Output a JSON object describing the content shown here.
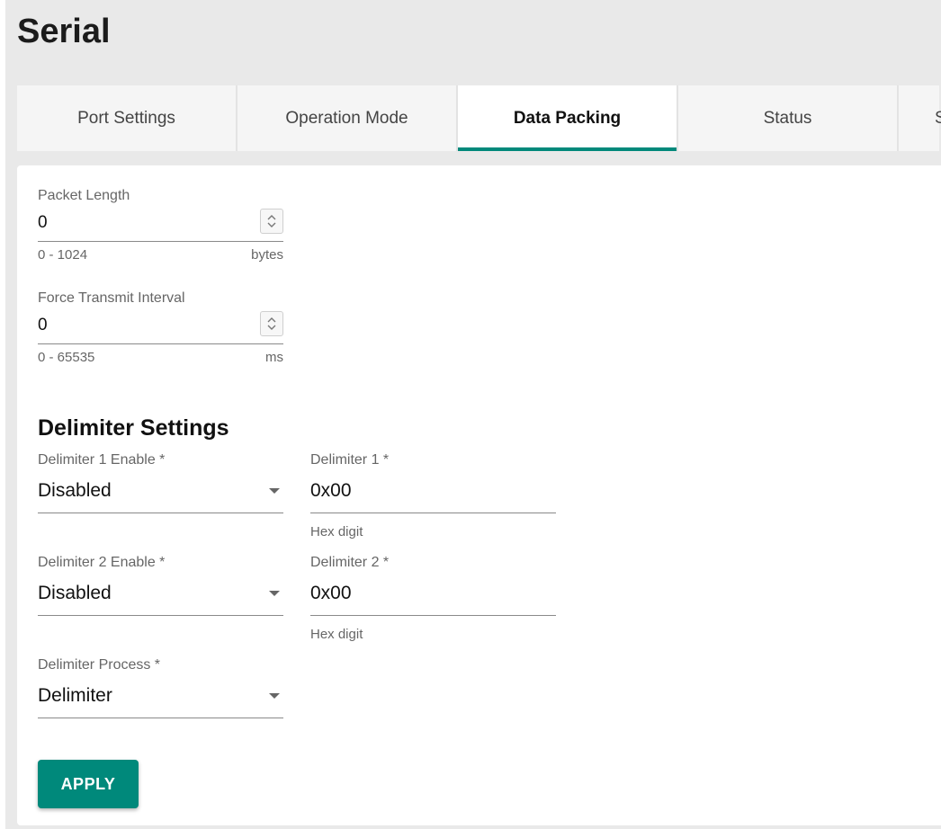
{
  "page": {
    "title": "Serial"
  },
  "tabs": [
    {
      "label": "Port Settings",
      "active": false
    },
    {
      "label": "Operation Mode",
      "active": false
    },
    {
      "label": "Data Packing",
      "active": true
    },
    {
      "label": "Status",
      "active": false
    },
    {
      "label": "S",
      "active": false
    }
  ],
  "packet_length": {
    "label": "Packet Length",
    "value": "0",
    "range": "0 - 1024",
    "unit": "bytes"
  },
  "force_transmit_interval": {
    "label": "Force Transmit Interval",
    "value": "0",
    "range": "0 - 65535",
    "unit": "ms"
  },
  "delimiter_settings": {
    "title": "Delimiter Settings",
    "delimiter1_enable": {
      "label": "Delimiter 1 Enable *",
      "value": "Disabled"
    },
    "delimiter1": {
      "label": "Delimiter 1 *",
      "value": "0x00",
      "hint": "Hex digit"
    },
    "delimiter2_enable": {
      "label": "Delimiter 2 Enable *",
      "value": "Disabled"
    },
    "delimiter2": {
      "label": "Delimiter 2 *",
      "value": "0x00",
      "hint": "Hex digit"
    },
    "delimiter_process": {
      "label": "Delimiter Process *",
      "value": "Delimiter"
    }
  },
  "actions": {
    "apply_label": "APPLY"
  },
  "colors": {
    "accent": "#00897b",
    "background": "#e9e9e9",
    "panel": "#ffffff"
  },
  "icons": {
    "stepper": "up-down-chevron-icon",
    "dropdown": "caret-down-icon"
  }
}
